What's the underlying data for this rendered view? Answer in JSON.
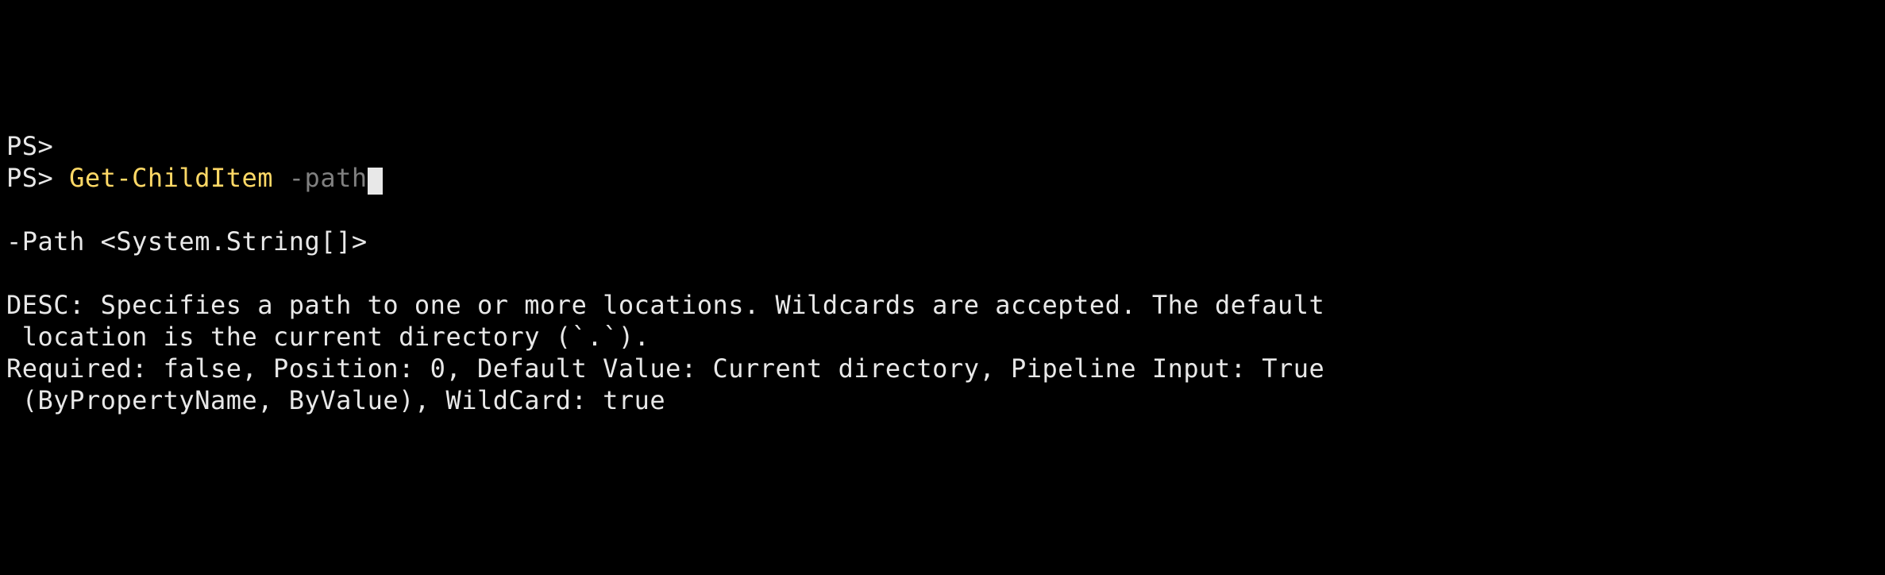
{
  "line1": {
    "prompt": "PS>"
  },
  "line2": {
    "prompt": "PS> ",
    "cmdlet": "Get-ChildItem",
    "space": " ",
    "param": "-path"
  },
  "help": {
    "syntax": "-Path <System.String[]>",
    "desc_label": "DESC: ",
    "desc_text": "Specifies a path to one or more locations. Wildcards are accepted. The default\n location is the current directory (`.`).",
    "props": "Required: false, Position: 0, Default Value: Current directory, Pipeline Input: True\n (ByPropertyName, ByValue), WildCard: true"
  }
}
